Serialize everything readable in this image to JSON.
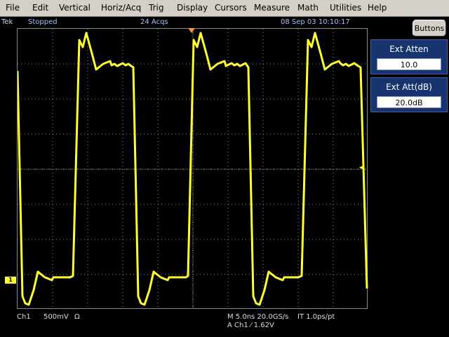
{
  "menu": {
    "items": [
      {
        "label": "File",
        "name": "menu-file"
      },
      {
        "label": "Edit",
        "name": "menu-edit"
      },
      {
        "label": "Vertical",
        "name": "menu-vertical"
      },
      {
        "label": "Horiz/Acq",
        "name": "menu-horiz-acq"
      },
      {
        "label": "Trig",
        "name": "menu-trig"
      },
      {
        "label": "Display",
        "name": "menu-display"
      },
      {
        "label": "Cursors",
        "name": "menu-cursors"
      },
      {
        "label": "Measure",
        "name": "menu-measure"
      },
      {
        "label": "Math",
        "name": "menu-math"
      },
      {
        "label": "Utilities",
        "name": "menu-utilities"
      },
      {
        "label": "Help",
        "name": "menu-help"
      }
    ]
  },
  "status": {
    "brand": "Tek",
    "state": "Stopped",
    "acqs": "24 Acqs",
    "datetime": "08 Sep 03 10:10:17"
  },
  "buttons_label": "Buttons",
  "side_panels": [
    {
      "title": "Ext Atten",
      "value": "10.0"
    },
    {
      "title": "Ext Att(dB)",
      "value": "20.0dB"
    }
  ],
  "readout": {
    "channel": "Ch1",
    "scale": "500mV",
    "coupling_symbol": "Ω",
    "horizontal": "M 5.0ns 20.0GS/s",
    "it": "IT 1.0ps/pt",
    "trigger": "A  Ch1  ⁄  1.62V"
  },
  "channel_marker": "1",
  "colors": {
    "trace": "#ffff33",
    "grid": "#8a8a8a",
    "panel": "#17346e"
  }
}
